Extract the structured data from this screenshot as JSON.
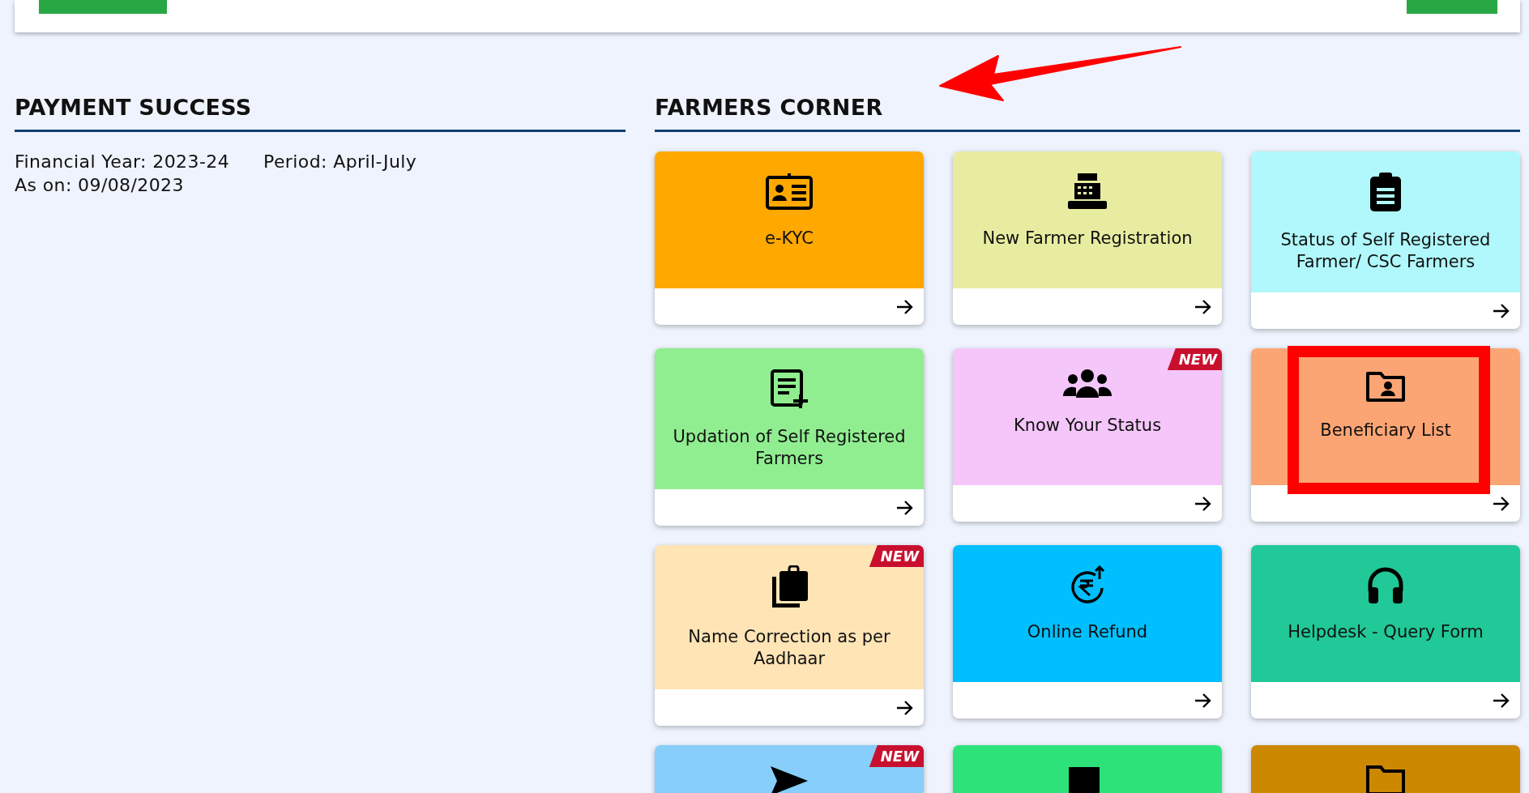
{
  "payment_success": {
    "title": "PAYMENT SUCCESS",
    "financial_year": "Financial Year: 2023-24",
    "period": "Period: April-July",
    "as_on": "As on: 09/08/2023"
  },
  "farmers_corner": {
    "title": "FARMERS CORNER",
    "cards": [
      {
        "label": "e-KYC",
        "color": "#ffa800"
      },
      {
        "label": "New Farmer Registration",
        "color": "#e8eca0"
      },
      {
        "label": "Status of Self Registered Farmer/ CSC Farmers",
        "color": "#b0f8fb"
      },
      {
        "label": "Updation of Self Registered Farmers",
        "color": "#90ee90"
      },
      {
        "label": "Know Your Status",
        "color": "#f5c6fa",
        "badge": "NEW"
      },
      {
        "label": "Beneficiary List",
        "color": "#fca574"
      },
      {
        "label": "Name Correction as per Aadhaar",
        "color": "#ffe4b5",
        "badge": "NEW"
      },
      {
        "label": "Online Refund",
        "color": "#00bfff"
      },
      {
        "label": "Helpdesk - Query Form",
        "color": "#20c997"
      },
      {
        "color": "#87cefa",
        "badge": "NEW"
      },
      {
        "color": "#2ee27a"
      },
      {
        "color": "#cc8800"
      }
    ]
  }
}
